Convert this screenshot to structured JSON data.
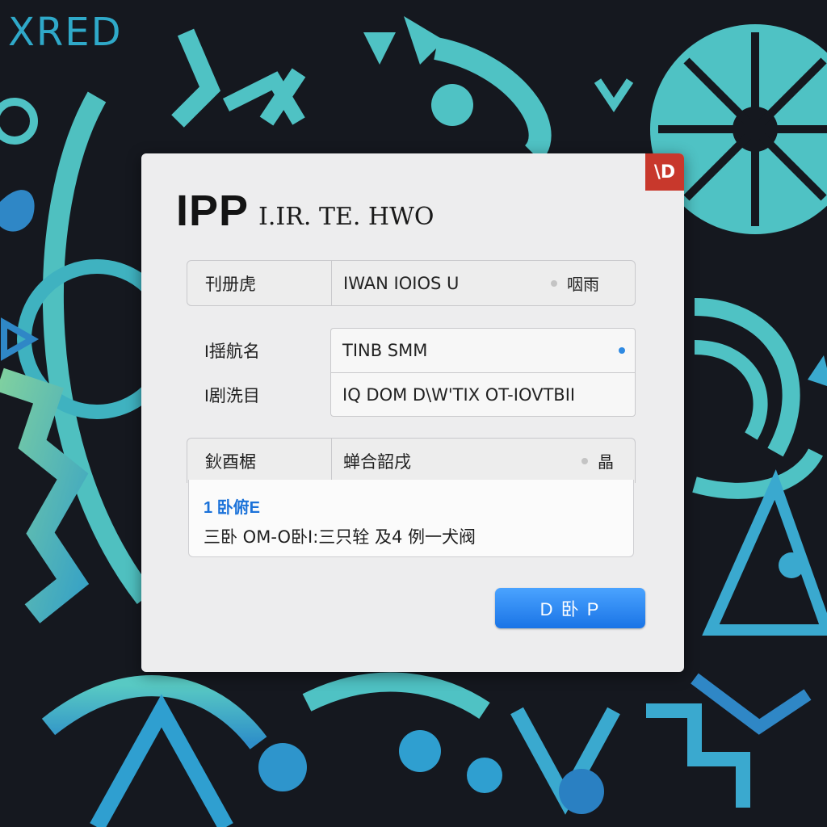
{
  "background_text": "XRED",
  "dialog": {
    "close_label": "\\D",
    "title_main": "IPP",
    "title_sub": "I.IR. TE. HWO",
    "group1": {
      "label": "刊册虎",
      "value": "IWAN  IOIOS U",
      "suffix": "咽雨"
    },
    "group2": {
      "rows": [
        {
          "label": "I揺航名",
          "value": "TINB SMM"
        },
        {
          "label": "I剧洗目",
          "value": "IQ DOM D\\W'TIX OT-IOVTBII"
        }
      ]
    },
    "group3": {
      "label": "鈥酉椐",
      "value": "蝉合韶戌",
      "suffix": "晶"
    },
    "notice": {
      "title": "1 卧俯E",
      "body": "三卧 OM-O卧I:三只辁 及4 例一犬阀"
    },
    "primary_button": "D  卧  P"
  },
  "colors": {
    "accent": "#1a74e6",
    "close": "#c8382c",
    "background": "#15181f",
    "pattern": "#4fc2c4"
  }
}
